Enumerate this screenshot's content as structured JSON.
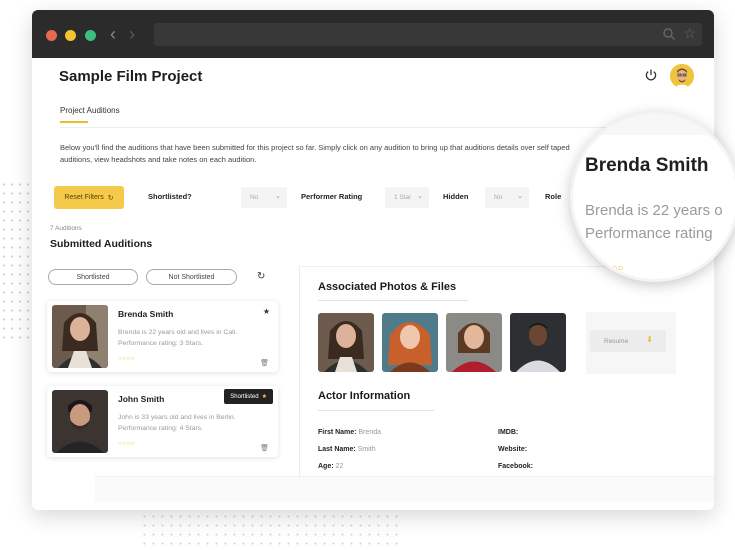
{
  "window": {
    "title_bar_controls": [
      "close",
      "minimize",
      "maximize"
    ]
  },
  "header": {
    "title": "Sample Film Project"
  },
  "tabs": [
    {
      "label": "Project Auditions",
      "active": true
    }
  ],
  "intro": "Below you'll find the auditions that have been submitted for this project so far. Simply click on any audition to bring up that auditions details over self taped auditions, view headshots and take notes on each audition.",
  "filters": {
    "reset_label": "Reset Filters",
    "shortlisted_label": "Shortlisted?",
    "shortlisted_value": "No",
    "performer_rating_label": "Performer Rating",
    "performer_rating_value": "1 Star",
    "hidden_label": "Hidden",
    "hidden_value": "No",
    "role_label": "Role"
  },
  "auditions": {
    "count_text": "7 Auditions",
    "title": "Submitted Auditions",
    "shortlisted_pill": "Shortlisted",
    "not_shortlisted_pill": "Not Shortlisted",
    "cards": [
      {
        "name": "Brenda Smith",
        "description": "Brenda is 22 years old and lives in Cali. Performance rating: 3 Stars.",
        "rating_stars": 3,
        "shortlisted": false,
        "rating_glyphs": "○○○○"
      },
      {
        "name": "John Smith",
        "description": "John is 33 years old and lives in Berlin. Performance rating: 4 Stars.",
        "rating_stars": 4,
        "shortlisted": true,
        "badge": "Shortlisted",
        "rating_glyphs": "○○○○"
      }
    ]
  },
  "details": {
    "photos_title": "Associated Photos & Files",
    "resume_label": "Resume",
    "actor_title": "Actor Information",
    "first_name_label": "First Name:",
    "first_name_value": "Brenda",
    "last_name_label": "Last Name:",
    "last_name_value": "Smith",
    "age_label": "Age:",
    "age_value": "22",
    "imdb_label": "IMDB:",
    "website_label": "Website:",
    "facebook_label": "Facebook:"
  },
  "magnifier": {
    "name": "Brenda Smith",
    "line1": "Brenda is 22 years o",
    "line2": "Performance rating",
    "rating_glyphs": "○○○"
  },
  "colors": {
    "accent": "#f5c94a",
    "dark": "#2b2b2b"
  },
  "icons": [
    "back-arrow-icon",
    "forward-arrow-icon",
    "search-icon",
    "star-icon",
    "power-icon",
    "avatar-icon",
    "refresh-icon",
    "trash-icon",
    "download-icon"
  ]
}
